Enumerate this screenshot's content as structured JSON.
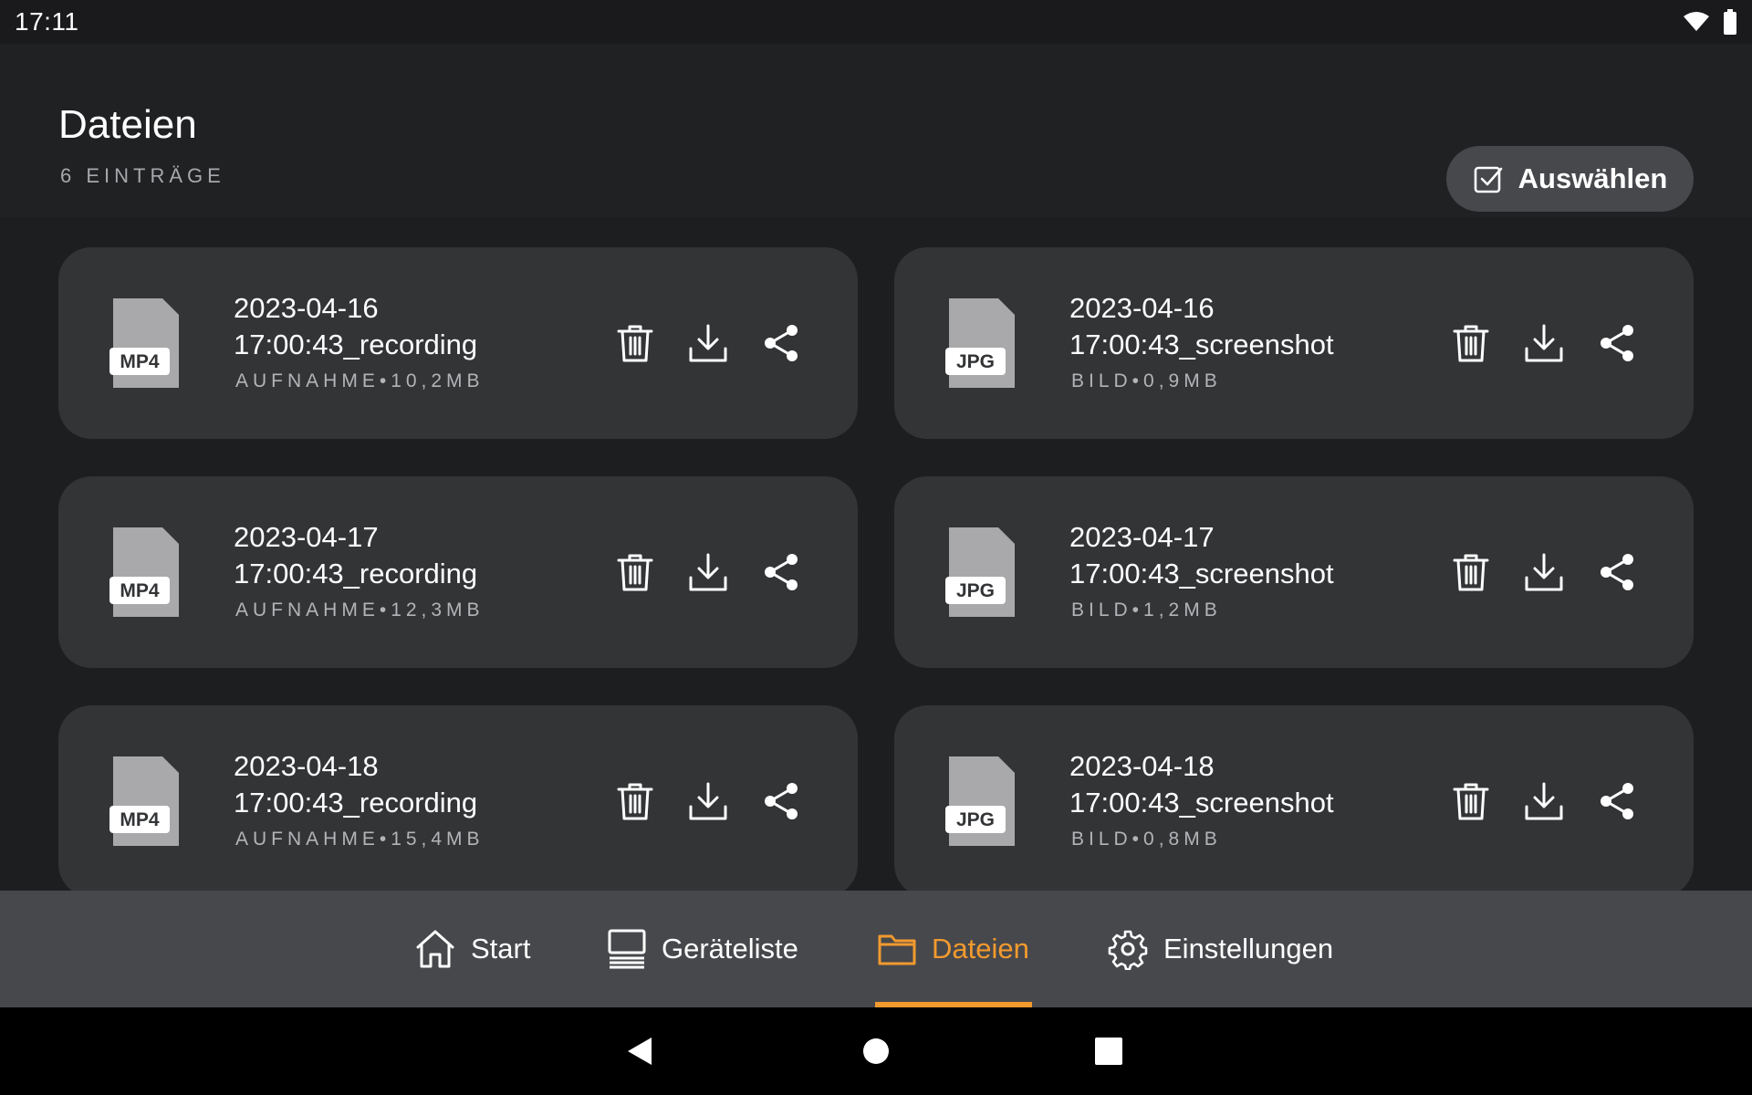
{
  "status_bar": {
    "time": "17:11"
  },
  "header": {
    "title": "Dateien",
    "count": "6 EINTRÄGE",
    "select_label": "Auswählen"
  },
  "files": [
    {
      "name_line1": "2023-04-16",
      "name_line2": "17:00:43_recording",
      "meta": "AUFNAHME•10,2MB",
      "type": "MP4"
    },
    {
      "name_line1": "2023-04-16",
      "name_line2": "17:00:43_screenshot",
      "meta": "BILD•0,9MB",
      "type": "JPG"
    },
    {
      "name_line1": "2023-04-17",
      "name_line2": "17:00:43_recording",
      "meta": "AUFNAHME•12,3MB",
      "type": "MP4"
    },
    {
      "name_line1": "2023-04-17",
      "name_line2": "17:00:43_screenshot",
      "meta": "BILD•1,2MB",
      "type": "JPG"
    },
    {
      "name_line1": "2023-04-18",
      "name_line2": "17:00:43_recording",
      "meta": "AUFNAHME•15,4MB",
      "type": "MP4"
    },
    {
      "name_line1": "2023-04-18",
      "name_line2": "17:00:43_screenshot",
      "meta": "BILD•0,8MB",
      "type": "JPG"
    }
  ],
  "bottom_nav": [
    {
      "label": "Start",
      "icon": "home-icon",
      "active": false
    },
    {
      "label": "Geräteliste",
      "icon": "device-list-icon",
      "active": false
    },
    {
      "label": "Dateien",
      "icon": "folder-icon",
      "active": true
    },
    {
      "label": "Einstellungen",
      "icon": "gear-icon",
      "active": false
    }
  ],
  "colors": {
    "accent": "#f29a2e",
    "background": "#1d1e20",
    "card": "#333436",
    "nav_bar": "#47484c"
  }
}
